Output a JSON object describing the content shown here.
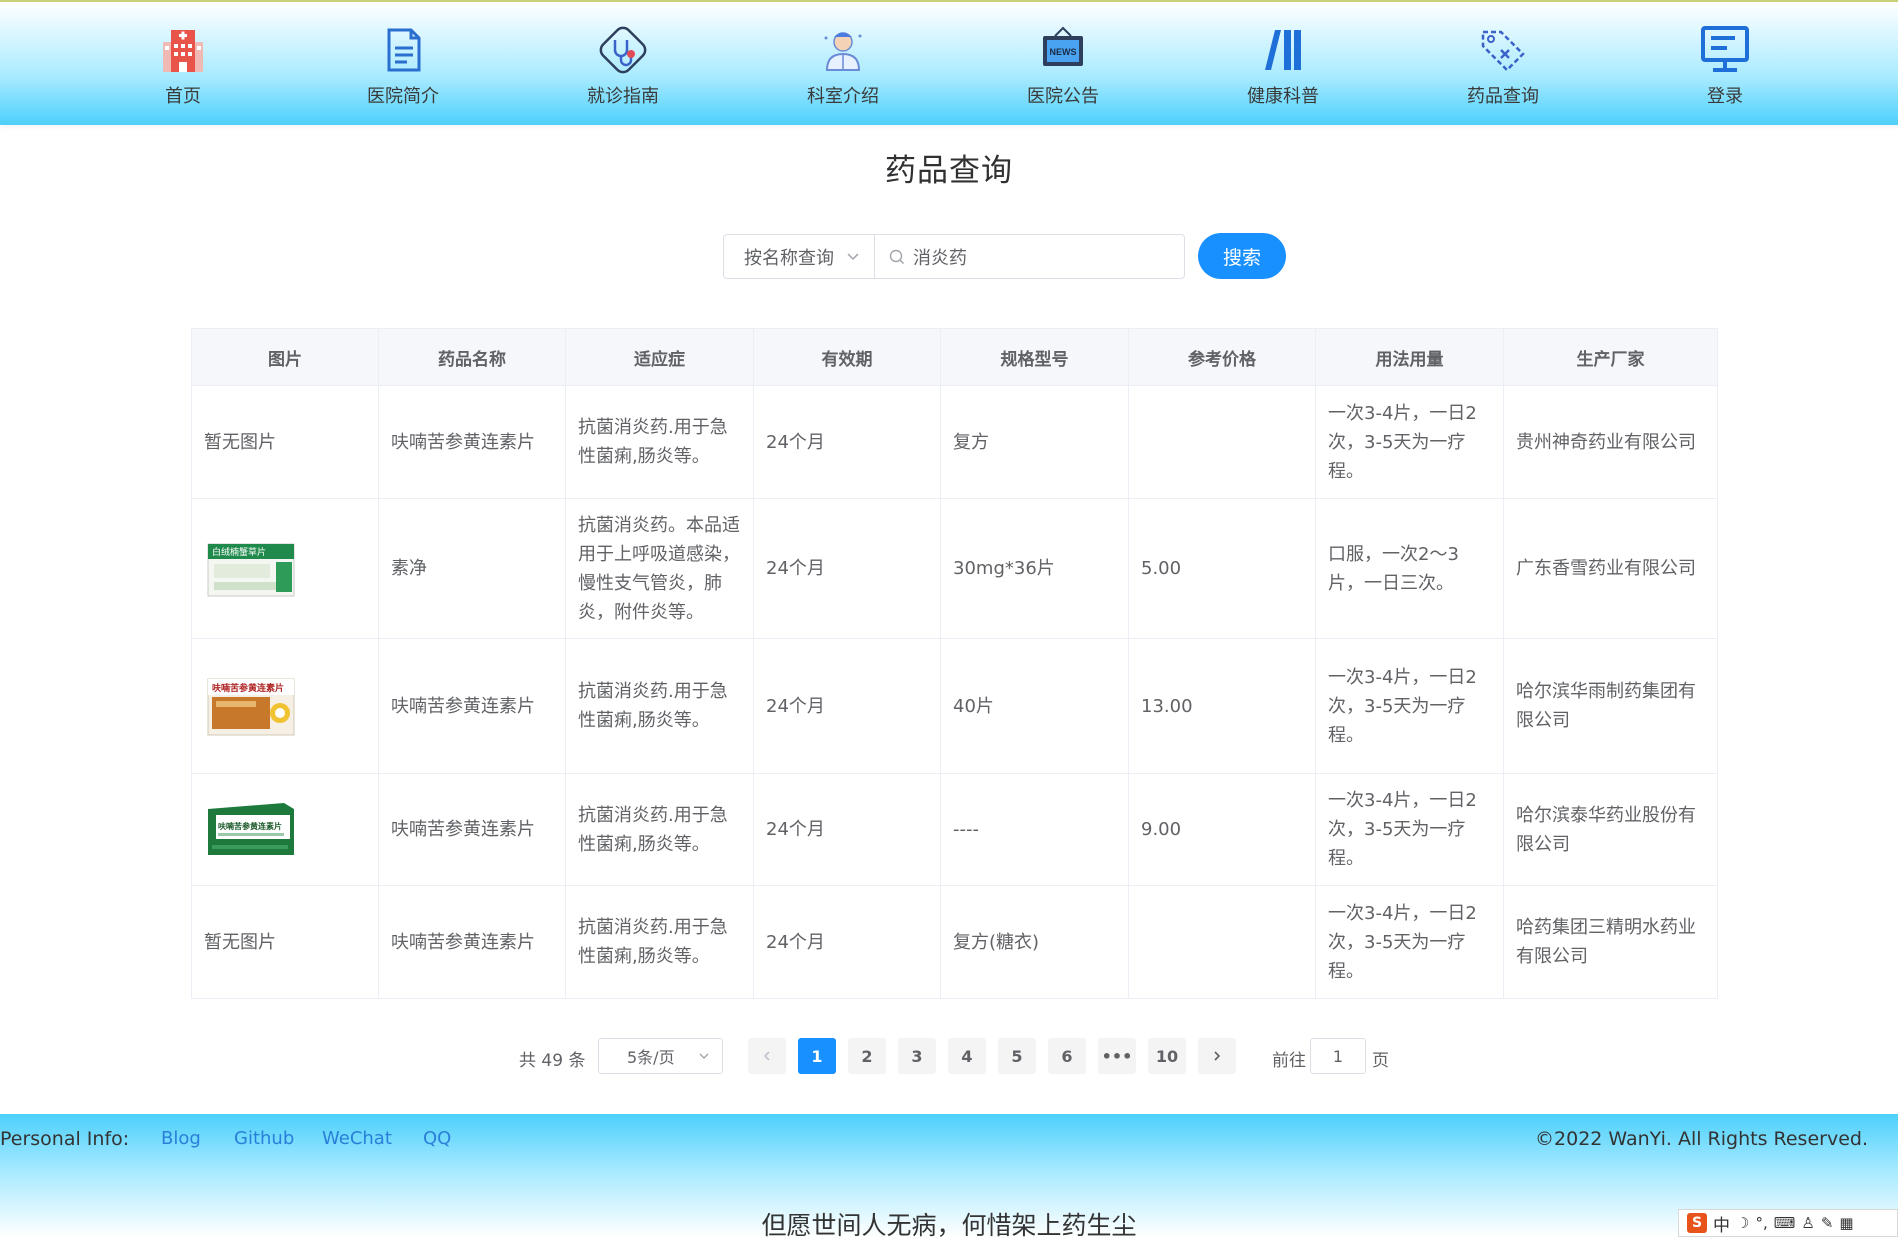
{
  "nav": {
    "items": [
      {
        "label": "首页",
        "icon": "hospital-icon"
      },
      {
        "label": "医院简介",
        "icon": "document-icon"
      },
      {
        "label": "就诊指南",
        "icon": "stethoscope-icon"
      },
      {
        "label": "科室介绍",
        "icon": "doctor-icon"
      },
      {
        "label": "医院公告",
        "icon": "news-icon"
      },
      {
        "label": "健康科普",
        "icon": "books-icon"
      },
      {
        "label": "药品查询",
        "icon": "tag-icon"
      },
      {
        "label": "登录",
        "icon": "monitor-icon"
      }
    ]
  },
  "page": {
    "title": "药品查询"
  },
  "search": {
    "mode_selected": "按名称查询",
    "query": "消炎药",
    "button_label": "搜索"
  },
  "table": {
    "headers": [
      "图片",
      "药品名称",
      "适应症",
      "有效期",
      "规格型号",
      "参考价格",
      "用法用量",
      "生产厂家"
    ],
    "rows": [
      {
        "image_text": "暂无图片",
        "has_image": false,
        "name": "呋喃苦参黄连素片",
        "indication": "抗菌消炎药.用于急性菌痢,肠炎等。",
        "validity": "24个月",
        "spec": "复方",
        "price": "",
        "usage": "一次3-4片，一日2次，3-5天为一疗程。",
        "maker": "贵州神奇药业有限公司"
      },
      {
        "image_text": "",
        "has_image": true,
        "image_label": "白绒楠蟹草片",
        "image_color": "#1f8a4c",
        "name": "素净",
        "indication": "抗菌消炎药。本品适用于上呼吸道感染，慢性支气管炎，肺炎，附件炎等。",
        "validity": "24个月",
        "spec": "30mg*36片",
        "price": "5.00",
        "usage": "口服，一次2～3片，一日三次。",
        "maker": "广东香雪药业有限公司"
      },
      {
        "image_text": "",
        "has_image": true,
        "image_label": "呋喃苦参黄连素片",
        "image_color": "#c8782a",
        "name": "呋喃苦参黄连素片",
        "indication": "抗菌消炎药.用于急性菌痢,肠炎等。",
        "validity": "24个月",
        "spec": "40片",
        "price": "13.00",
        "usage": "一次3-4片，一日2次，3-5天为一疗程。",
        "maker": "哈尔滨华雨制药集团有限公司"
      },
      {
        "image_text": "",
        "has_image": true,
        "image_label": "呋喃苦参黄连素片",
        "image_color": "#1d7a3c",
        "name": "呋喃苦参黄连素片",
        "indication": "抗菌消炎药.用于急性菌痢,肠炎等。",
        "validity": "24个月",
        "spec": "----",
        "price": "9.00",
        "usage": "一次3-4片，一日2次，3-5天为一疗程。",
        "maker": "哈尔滨泰华药业股份有限公司"
      },
      {
        "image_text": "暂无图片",
        "has_image": false,
        "name": "呋喃苦参黄连素片",
        "indication": "抗菌消炎药.用于急性菌痢,肠炎等。",
        "validity": "24个月",
        "spec": "复方(糖衣)",
        "price": "",
        "usage": "一次3-4片，一日2次，3-5天为一疗程。",
        "maker": "哈药集团三精明水药业有限公司"
      }
    ]
  },
  "pagination": {
    "total_text": "共 49 条",
    "page_size_text": "5条/页",
    "pages": [
      "1",
      "2",
      "3",
      "4",
      "5",
      "6",
      "•••",
      "10"
    ],
    "current_page": "1",
    "goto_label": "前往",
    "goto_value": "1",
    "goto_suffix": "页"
  },
  "footer": {
    "personal_info_label": "Personal Info:",
    "links": [
      "Blog",
      "Github",
      "WeChat",
      "QQ"
    ],
    "copyright": "©2022 WanYi. All Rights Reserved.",
    "motto": "但愿世间人无病，何惜架上药生尘"
  },
  "ime": {
    "logo": "S",
    "mode": "中"
  },
  "colors": {
    "accent": "#1890ff",
    "header_gradient_end": "#4cd0fb"
  }
}
